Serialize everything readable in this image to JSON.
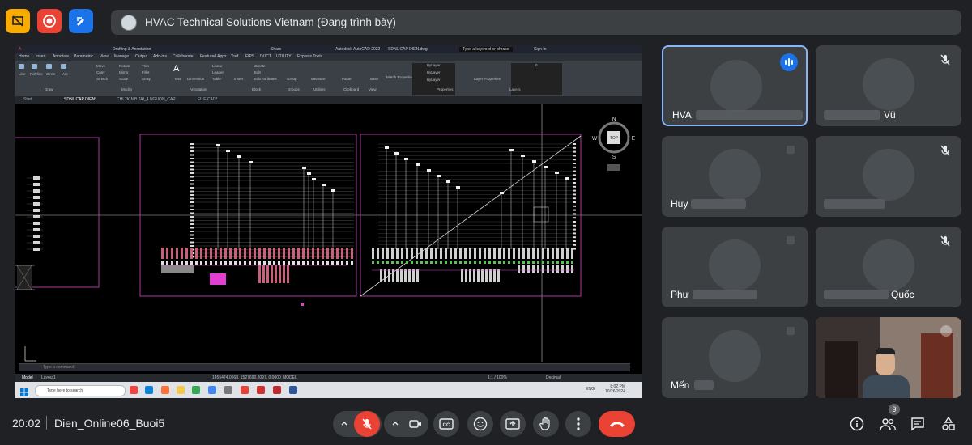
{
  "top_icons": [
    "present-off-icon",
    "record-icon",
    "whiteboard-icon"
  ],
  "meeting_title": {
    "presenter": "HVAC Technical Solutions Vietnam (Đang trình bày)"
  },
  "autocad": {
    "app_title": "Autodesk AutoCAD 2022",
    "file_name": "SDNL CAP DIEN.dwg",
    "search_placeholder": "Type a keyword or phrase",
    "sign_in": "Sign In",
    "share": "Share",
    "workspace": "Drafting & Annotation",
    "ribbon_tabs": [
      "Home",
      "Insert",
      "Annotate",
      "Parametric",
      "View",
      "Manage",
      "Output",
      "Add-ins",
      "Collaborate",
      "Featured Apps",
      "Xref",
      "FIPS",
      "DUCT",
      "UTILITY",
      "Express Tools"
    ],
    "ribbon_groups": [
      "Draw",
      "Modify",
      "Annotation",
      "Block",
      "Groups",
      "Utilities",
      "Clipboard",
      "View",
      "Properties",
      "Layers"
    ],
    "ribbon_tools": [
      "Line",
      "Polyline",
      "Circle",
      "Arc",
      "Move",
      "Rotate",
      "Trim",
      "Copy",
      "Mirror",
      "Fillet",
      "Stretch",
      "Scale",
      "Array",
      "Text",
      "Dimension",
      "Linear",
      "Leader",
      "Table",
      "Insert",
      "Create",
      "Edit",
      "Edit Attributes",
      "Group",
      "Measure",
      "Paste",
      "Base",
      "Match Properties",
      "Layer Properties",
      "Make Current",
      "Match Layer"
    ],
    "bylayer": "ByLayer",
    "doc_tabs": [
      "Start",
      "SDNL CAP DIEN*",
      "CHL2K-MB TAI_4 NGUON_CAP",
      "FILE CAD*"
    ],
    "viewcube": {
      "top": "TOP",
      "n": "N",
      "s": "S",
      "e": "E",
      "w": "W"
    },
    "command_placeholder": "Type a command",
    "layout_tabs": [
      "Model",
      "Layout1",
      "Layout2"
    ],
    "coords": "1455474.0668, 1527690.2097, 0.0000",
    "status_model": "MODEL",
    "scale": "1:1 / 100%",
    "units": "Decimal"
  },
  "windows_taskbar": {
    "search_placeholder": "Type here to search",
    "lang": "ENG",
    "time": "8:02 PM",
    "date": "10/26/2024"
  },
  "participants": [
    {
      "name": "HVA",
      "speaking": true,
      "muted": false
    },
    {
      "name": "Vũ",
      "muted": true
    },
    {
      "name": "Huy",
      "muted": false
    },
    {
      "name": "",
      "muted": true
    },
    {
      "name": "Phư",
      "muted": false
    },
    {
      "name": "Quốc",
      "muted": true
    },
    {
      "name": "Mến",
      "muted": false
    },
    {
      "name": "",
      "muted": false,
      "video": true
    }
  ],
  "bottom": {
    "time": "20:02",
    "meeting_name": "Dien_Online06_Buoi5",
    "people_count": "9"
  },
  "colors": {
    "accent_red": "#ea4335",
    "accent_blue": "#1a73e8",
    "tile_bg": "#3c4043",
    "page_bg": "#202124"
  }
}
